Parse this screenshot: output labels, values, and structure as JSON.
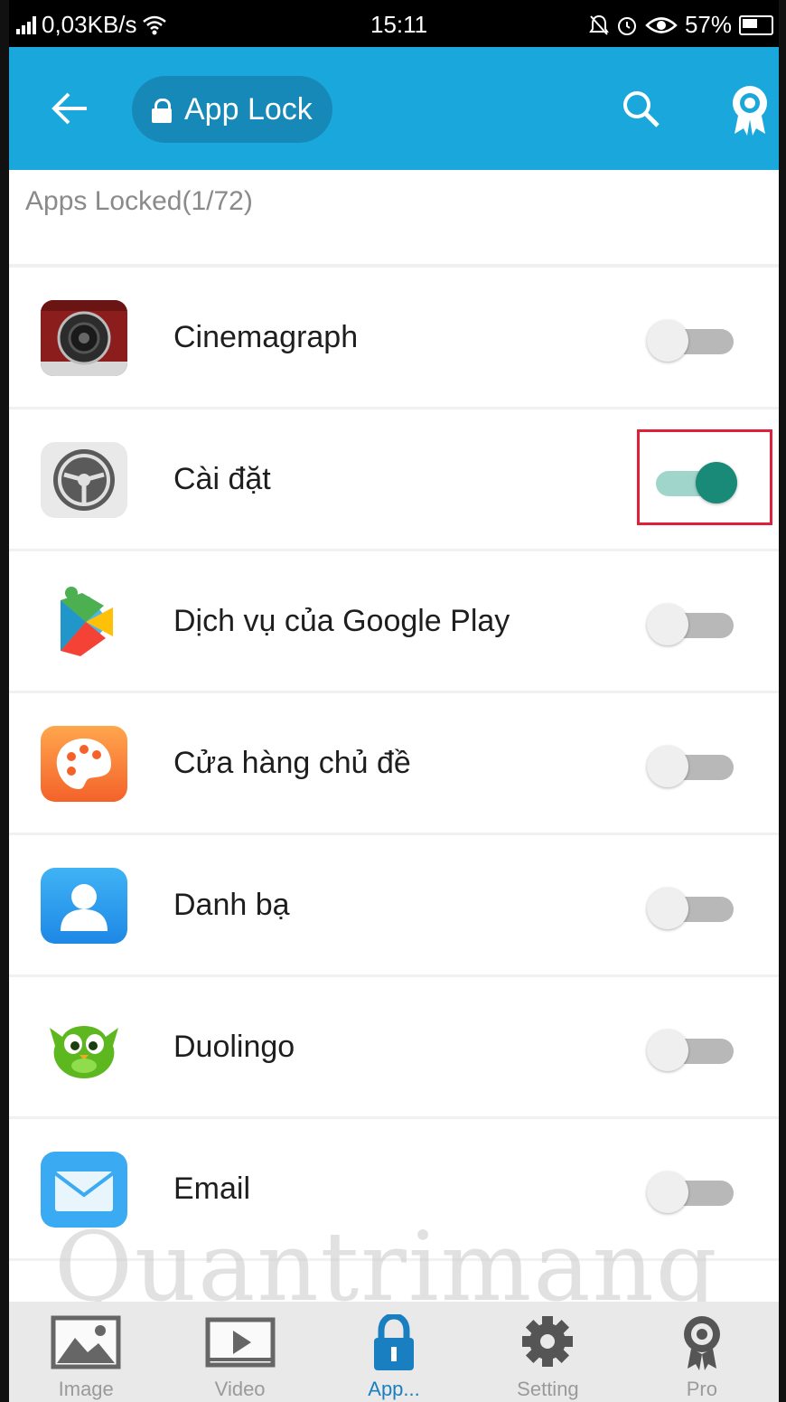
{
  "status_bar": {
    "speed": "0,03KB/s",
    "time": "15:11",
    "battery": "57%"
  },
  "app_bar": {
    "title": "App Lock"
  },
  "section": {
    "header": "Apps Locked(1/72)"
  },
  "apps": [
    {
      "name": "Cinemagraph",
      "locked": false
    },
    {
      "name": "Cài đặt",
      "locked": true
    },
    {
      "name": "Dịch vụ của Google Play",
      "locked": false
    },
    {
      "name": "Cửa hàng chủ đề",
      "locked": false
    },
    {
      "name": "Danh bạ",
      "locked": false
    },
    {
      "name": "Duolingo",
      "locked": false
    },
    {
      "name": "Email",
      "locked": false
    }
  ],
  "bottom_nav": {
    "items": [
      {
        "label": "Image",
        "icon": "image-icon"
      },
      {
        "label": "Video",
        "icon": "video-icon"
      },
      {
        "label": "App...",
        "icon": "lock-icon",
        "active": true
      },
      {
        "label": "Setting",
        "icon": "gear-icon"
      },
      {
        "label": "Pro",
        "icon": "award-icon"
      }
    ]
  },
  "watermark": "Quantrimang",
  "colors": {
    "app_bar": "#1aa7dc",
    "title_pill": "#1789b8",
    "toggle_on": "#1a8a78",
    "highlight": "#e0203a"
  }
}
